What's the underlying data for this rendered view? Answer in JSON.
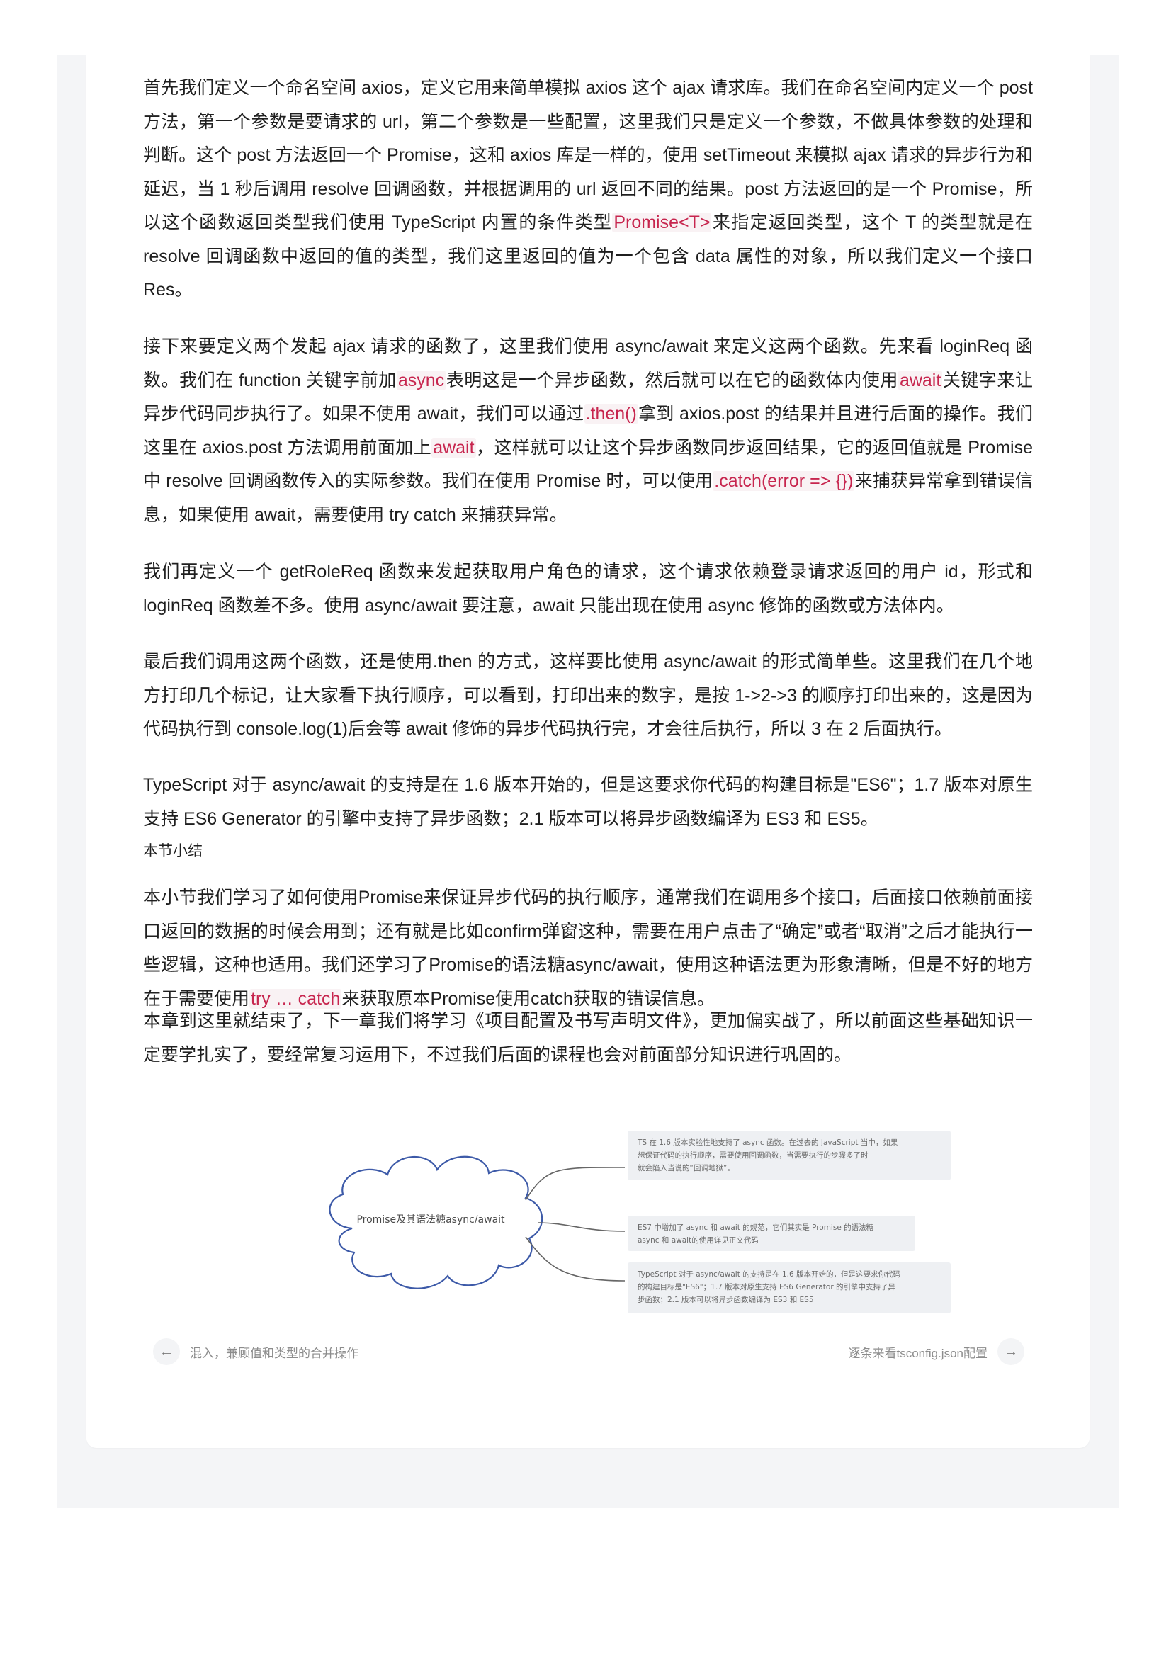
{
  "paragraphs": {
    "p1": {
      "a": "首先我们定义一个命名空间 axios，定义它用来简单模拟 axios 这个 ajax 请求库。我们在命名空间内定义一个 post 方法，第一个参数是要请求的 url，第二个参数是一些配置，这里我们只是定义一个参数，不做具体参数的处理和判断。这个 post 方法返回一个 Promise，这和 axios 库是一样的，使用 setTimeout 来模拟 ajax 请求的异步行为和延迟，当 1 秒后调用 resolve 回调函数，并根据调用的 url 返回不同的结果。post 方法返回的是一个 Promise，所以这个函数返回类型我们使用 TypeScript 内置的条件类型",
      "code1": "Promise<T>",
      "b": "来指定返回类型，这个 T 的类型就是在 resolve 回调函数中返回的值的类型，我们这里返回的值为一个包含 data 属性的对象，所以我们定义一个接口 Res。"
    },
    "p2": {
      "a": "接下来要定义两个发起 ajax 请求的函数了，这里我们使用 async/await 来定义这两个函数。先来看 loginReq 函数。我们在 function 关键字前加",
      "code1": "async",
      "b": "表明这是一个异步函数，然后就可以在它的函数体内使用",
      "code2": "await",
      "c": "关键字来让异步代码同步执行了。如果不使用 await，我们可以通过",
      "code3": ".then()",
      "d": "拿到 axios.post 的结果并且进行后面的操作。我们这里在 axios.post 方法调用前面加上",
      "code4": "await",
      "e": "，这样就可以让这个异步函数同步返回结果，它的返回值就是 Promise 中 resolve 回调函数传入的实际参数。我们在使用 Promise 时，可以使用",
      "code5": ".catch(error => {})",
      "f": "来捕获异常拿到错误信息，如果使用 await，需要使用 try catch 来捕获异常。"
    },
    "p3": "我们再定义一个 getRoleReq 函数来发起获取用户角色的请求，这个请求依赖登录请求返回的用户 id，形式和 loginReq 函数差不多。使用 async/await 要注意，await 只能出现在使用 async 修饰的函数或方法体内。",
    "p4": "最后我们调用这两个函数，还是使用.then 的方式，这样要比使用 async/await 的形式简单些。这里我们在几个地方打印几个标记，让大家看下执行顺序，可以看到，打印出来的数字，是按 1->2->3 的顺序打印出来的，这是因为代码执行到 console.log(1)后会等 await 修饰的异步代码执行完，才会往后执行，所以 3 在 2 后面执行。",
    "p5": "TypeScript 对于 async/await 的支持是在 1.6 版本开始的，但是这要求你代码的构建目标是\"ES6\"；1.7 版本对原生支持 ES6 Generator 的引擎中支持了异步函数；2.1 版本可以将异步函数编译为 ES3 和 ES5。",
    "heading": "本节小结",
    "p6": "本小节我们学习了如何使用Promise来保证异步代码的执行顺序，通常我们在调用多个接口，后面接口依赖前面接口返回的数据的时候会用到；还有就是比如confirm弹窗这种，需要在用户点击了“确定”或者“取消”之后才能执行一些逻辑，这种也适用。我们还学习了Promise的语法糖async/await，使用这种语法更为形象清晰，但是不好的地方在于需要使用",
    "p6_code": "try … catch",
    "p6_b": "来获取原本Promise使用catch获取的错误信息。",
    "p7": "本章到这里就结束了，下一章我们将学习《项目配置及书写声明文件》，更加偏实战了，所以前面这些基础知识一定要学扎实了，要经常复习运用下，不过我们后面的课程也会对前面部分知识进行巩固的。"
  },
  "mindmap": {
    "center": "Promise及其语法糖async/await",
    "branches": [
      [
        "TS 在 1.6 版本实验性地支持了 async 函数。在过去的 JavaScript 当中，如果",
        "想保证代码的执行顺序，需要使用回调函数，当需要执行的步骤多了时",
        "就会陷入当说的“回调地狱”。"
      ],
      [
        "ES7 中增加了 async 和 await 的规范，它们其实是 Promise 的语法糖",
        "async 和 await的使用详见正文代码"
      ],
      [
        "TypeScript 对于 async/await 的支持是在 1.6 版本开始的，但是这要求你代码",
        "的构建目标是\"ES6\"；1.7 版本对原生支持 ES6 Generator 的引擎中支持了异",
        "步函数；2.1 版本可以将异步函数编译为 ES3 和 ES5"
      ]
    ]
  },
  "nav": {
    "prev_label": "混入，兼顾值和类型的合并操作",
    "next_label": "逐条来看tsconfig.json配置",
    "prev_icon": "arrow-left-icon",
    "next_icon": "arrow-right-icon"
  }
}
